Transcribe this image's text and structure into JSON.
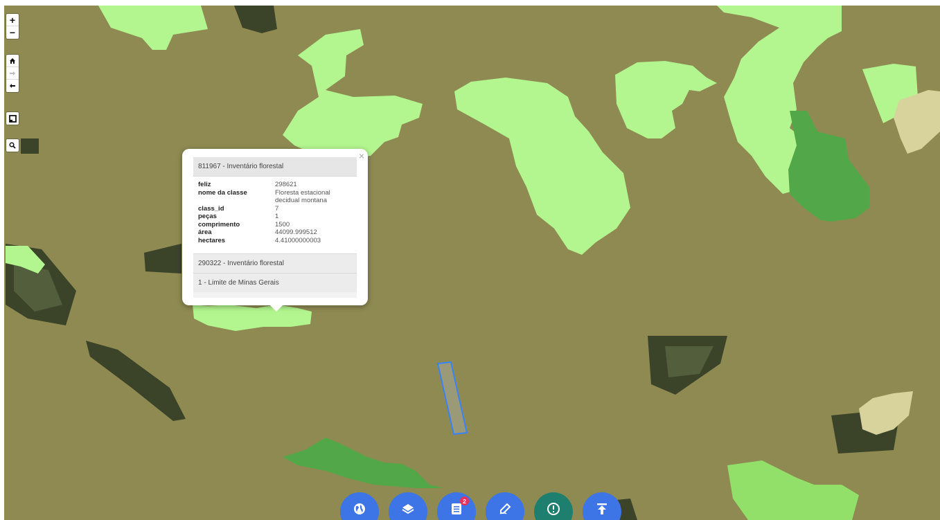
{
  "map": {
    "background_color": "#8e8a52",
    "legend_colors": {
      "floresta_light": "#b3f58f",
      "floresta_green": "#52a848",
      "pasture_beige": "#d8d39c",
      "selection_outline": "#3b82f6"
    }
  },
  "controls": {
    "zoom_in_label": "+",
    "zoom_out_label": "−",
    "home_icon": "home-icon",
    "forward_icon": "arrow-right-icon",
    "back_icon": "arrow-left-icon",
    "fullscreen_icon": "square-icon",
    "search_icon": "search-icon"
  },
  "popup": {
    "close_label": "×",
    "header": "811967 - Inventário florestal",
    "rows": [
      {
        "key": "feliz",
        "value": "298621"
      },
      {
        "key": "nome da classe",
        "value": "Floresta estacional decidual montana"
      },
      {
        "key": "class_id",
        "value": "7"
      },
      {
        "key": "peças",
        "value": "1"
      },
      {
        "key": "comprimento",
        "value": "1500"
      },
      {
        "key": "área",
        "value": "44099.999512"
      },
      {
        "key": "hectares",
        "value": "4.41000000003"
      }
    ],
    "footer_items": [
      "290322 - Inventário florestal",
      "1 - Limite de Minas Gerais"
    ]
  },
  "toolbar": {
    "buttons": [
      {
        "icon": "globe-icon"
      },
      {
        "icon": "layers-icon"
      },
      {
        "icon": "list-icon",
        "badge": "2"
      },
      {
        "icon": "draw-icon"
      },
      {
        "icon": "alert-icon"
      },
      {
        "icon": "upload-icon"
      }
    ]
  }
}
